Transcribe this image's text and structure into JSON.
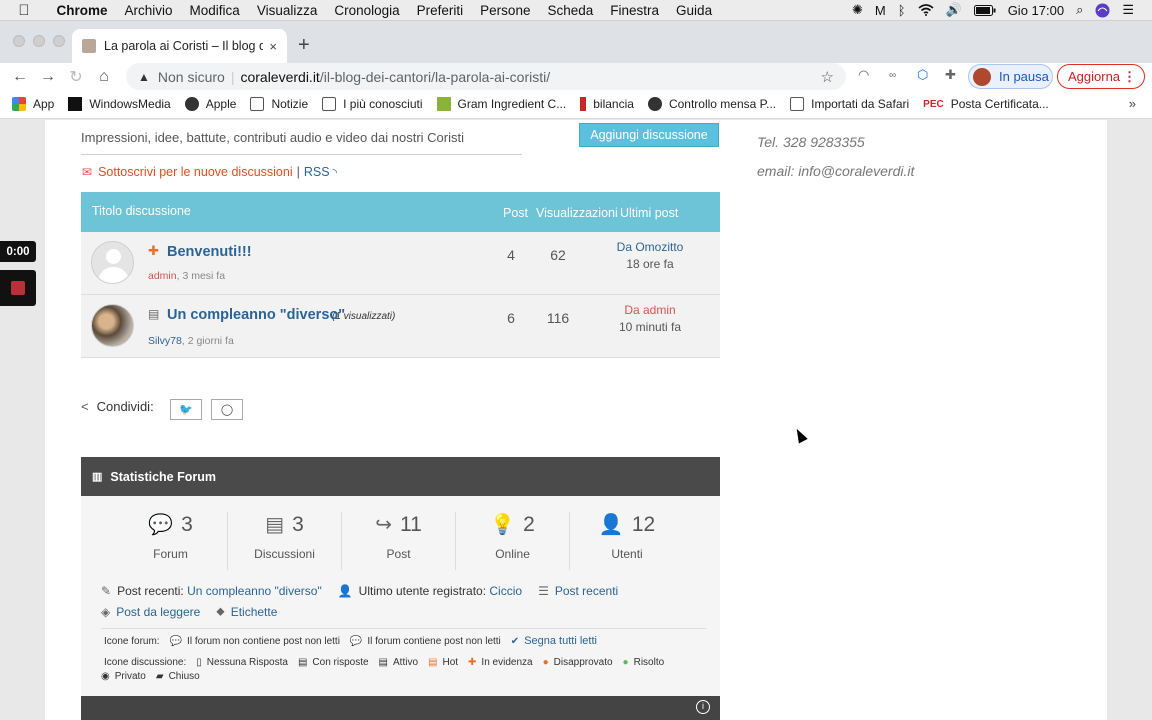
{
  "menubar": {
    "app": "Chrome",
    "items": [
      "Archivio",
      "Modifica",
      "Visualizza",
      "Cronologia",
      "Preferiti",
      "Persone",
      "Scheda",
      "Finestra",
      "Guida"
    ],
    "clock": "Gio 17:00"
  },
  "tab": {
    "title": "La parola ai Coristi – Il blog dei",
    "close": "×"
  },
  "newtab": "+",
  "toolbar": {
    "back": "←",
    "forward": "→",
    "reload": "↻",
    "home": "⌂",
    "security": "Non sicuro",
    "url_domain": "coraleverdi.it",
    "url_path": "/il-blog-dei-cantori/la-parola-ai-coristi/",
    "pause_label": "In pausa",
    "update_label": "Aggiorna"
  },
  "bookmarks": {
    "items": [
      {
        "label": "App",
        "icon": "apps-grid-icon"
      },
      {
        "label": "WindowsMedia",
        "icon": "windowsmedia-icon"
      },
      {
        "label": "Apple",
        "icon": "globe-icon"
      },
      {
        "label": "Notizie",
        "icon": "folder-icon"
      },
      {
        "label": "I più conosciuti",
        "icon": "folder-icon"
      },
      {
        "label": "Gram Ingredient C...",
        "icon": "gram-icon"
      },
      {
        "label": "bilancia",
        "icon": "bilancia-icon"
      },
      {
        "label": "Controllo mensa P...",
        "icon": "globe-icon"
      },
      {
        "label": "Importati da Safari",
        "icon": "folder-icon"
      },
      {
        "label": "Posta Certificata...",
        "icon": "pec-icon"
      }
    ],
    "more": "»"
  },
  "page": {
    "description": "Impressioni, idee, battute, contributi audio e video dai nostri Coristi",
    "add_discussion": "Aggiungi discussione",
    "subscribe": "Sottoscrivi per le nuove discussioni",
    "rss": "RSS",
    "table": {
      "headers": {
        "title": "Titolo discussione",
        "posts": "Post",
        "views": "Visualizzazioni",
        "last": "Ultimi post"
      },
      "rows": [
        {
          "title": "Benvenuti!!!",
          "author": "admin",
          "ago": ", 3 mesi fa",
          "posts": "4",
          "views": "62",
          "last_by": "Da Omozitto",
          "last_when": "18 ore fa"
        },
        {
          "title": "Un compleanno \"diverso\"",
          "viewed_note": "(1 visualizzati)",
          "author": "Silvy78",
          "ago": ", 2 giorni fa",
          "posts": "6",
          "views": "116",
          "last_by": "Da admin",
          "last_when": "10 minuti fa"
        }
      ]
    },
    "share_label": "Condividi:",
    "stats": {
      "title": "Statistiche Forum",
      "cells": [
        {
          "value": "3",
          "label": "Forum"
        },
        {
          "value": "3",
          "label": "Discussioni"
        },
        {
          "value": "11",
          "label": "Post"
        },
        {
          "value": "2",
          "label": "Online"
        },
        {
          "value": "12",
          "label": "Utenti"
        }
      ],
      "recent_posts_label": "Post recenti:",
      "recent_posts_link": "Un compleanno \"diverso\"",
      "last_user_label": "Ultimo utente registrato:",
      "last_user_link": "Ciccio",
      "recent_link": "Post recenti",
      "to_read": "Post da leggere",
      "tags": "Etichette",
      "forum_icons_label": "Icone forum:",
      "forum_no_unread": "Il forum non contiene post non letti",
      "forum_unread": "Il forum contiene post non letti",
      "mark_all_read": "Segna tutti letti",
      "topic_icons_label": "Icone discussione:",
      "topic_items": [
        "Nessuna Risposta",
        "Con risposte",
        "Attivo",
        "Hot",
        "In evidenza",
        "Disapprovato",
        "Risolto"
      ],
      "private": "Privato",
      "closed": "Chiuso"
    },
    "contact": {
      "tel": "Tel. 328 9283355",
      "email": "email: info@coraleverdi.it"
    }
  },
  "recorder": {
    "time": "0:00"
  }
}
